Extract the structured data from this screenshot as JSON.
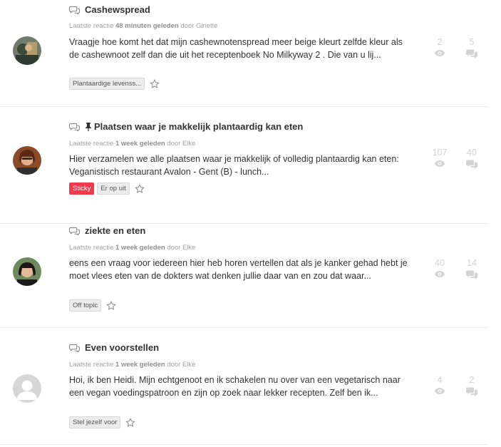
{
  "topics": [
    {
      "title": "Cashewspread",
      "pinned": false,
      "meta_prefix": "Laatste reactie",
      "meta_time": "48 minuten geleden",
      "meta_by": "door Ginette",
      "excerpt": "Vraagje hoe komt het dat mijn cashewnotenspread meer beige kleurt zelfde kleur als de cashewnoot zelf dan die uit het receptenboek No Milkyway 2 . Die van u lij...",
      "tags": [
        "Plantaardige levenss..."
      ],
      "views": "2",
      "replies": "5"
    },
    {
      "title": "Plaatsen waar je makkelijk plantaardig kan eten",
      "pinned": true,
      "meta_prefix": "Laatste reactie",
      "meta_time": "1 week geleden",
      "meta_by": "door Elke",
      "excerpt": "Hier verzamelen we alle plaatsen waar je makkelijk of volledig plantaardig kan eten: Veganistisch restaurant Avalon - Gent (B) - lunch...",
      "sticky_label": "Sticky",
      "tags": [
        "Er op uit"
      ],
      "views": "107",
      "replies": "40"
    },
    {
      "title": "ziekte en eten",
      "pinned": false,
      "meta_prefix": "Laatste reactie",
      "meta_time": "1 week geleden",
      "meta_by": "door Elke",
      "excerpt": "eens een vraag voor iedereen hier heb horen vertellen dat als je kanker gehad hebt je moet vlees eten van de dokters wat denken jullie daar van en zou dat waar...",
      "tags": [
        "Off topic"
      ],
      "views": "40",
      "replies": "14"
    },
    {
      "title": "Even voorstellen",
      "pinned": false,
      "meta_prefix": "Laatste reactie",
      "meta_time": "1 week geleden",
      "meta_by": "door Elke",
      "excerpt": "Hoi, ik ben Heidi. Mijn echtgenoot en ik schakelen nu over van een vegetarisch naar een vegan voedingspatroon en zijn op zoek naar lekker recepten. Zelf ben ik...",
      "tags": [
        "Stel jezelf voor"
      ],
      "views": "4",
      "replies": "2"
    }
  ],
  "colors": {
    "sticky": "#f2394b",
    "stat": "#d4d4d4",
    "meta": "#a3a3a3"
  }
}
